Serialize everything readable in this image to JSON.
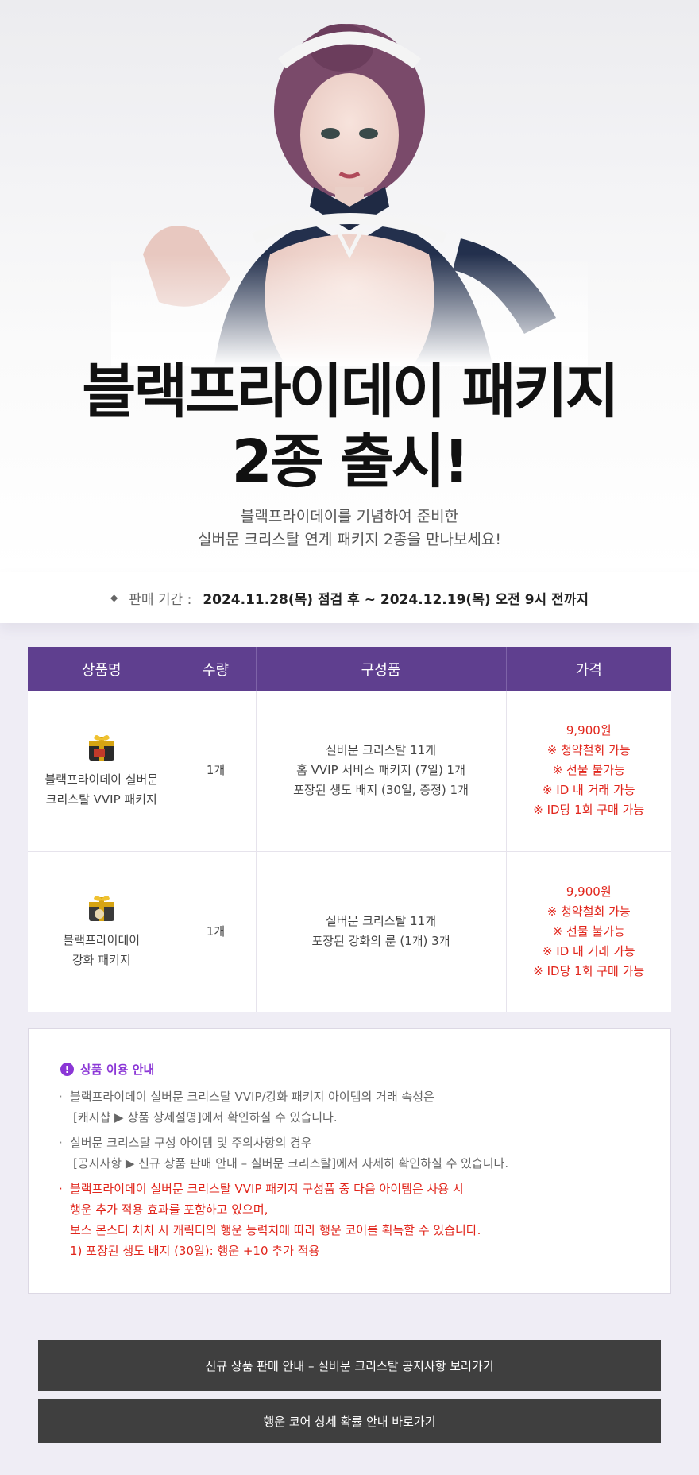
{
  "hero": {
    "headline_line1": "블랙프라이데이 패키지",
    "headline_line2": "2종 출시!",
    "sub_line1": "블랙프라이데이를 기념하여 준비한",
    "sub_line2": "실버문 크리스탈 연계 패키지 2종을 만나보세요!"
  },
  "period": {
    "label": "판매 기간 :",
    "value": "2024.11.28(목) 점검 후 ~ 2024.12.19(목) 오전 9시 전까지"
  },
  "table": {
    "headers": [
      "상품명",
      "수량",
      "구성품",
      "가격"
    ],
    "rows": [
      {
        "icon": "vvip-package-box-icon",
        "name_line1": "블랙프라이데이 실버문",
        "name_line2": "크리스탈 VVIP 패키지",
        "qty": "1개",
        "items": [
          "실버문 크리스탈 11개",
          "홈 VVIP 서비스 패키지 (7일) 1개",
          "포장된 생도 배지 (30일, 증정) 1개"
        ],
        "price": [
          "9,900원",
          "※ 청약철회 가능",
          "※ 선물 불가능",
          "※ ID 내 거래 가능",
          "※ ID당 1회 구매 가능"
        ]
      },
      {
        "icon": "enhance-package-box-icon",
        "name_line1": "블랙프라이데이",
        "name_line2": "강화 패키지",
        "qty": "1개",
        "items": [
          "실버문 크리스탈 11개",
          "포장된 강화의 룬 (1개) 3개"
        ],
        "price": [
          "9,900원",
          "※ 청약철회 가능",
          "※ 선물 불가능",
          "※ ID 내 거래 가능",
          "※ ID당 1회 구매 가능"
        ]
      }
    ]
  },
  "notice": {
    "title": "상품 이용 안내",
    "items": [
      {
        "lines": [
          "블랙프라이데이 실버문 크리스탈 VVIP/강화 패키지 아이템의 거래 속성은",
          "[캐시샵 ▶ 상품 상세설명]에서 확인하실 수 있습니다."
        ]
      },
      {
        "lines": [
          "실버문 크리스탈 구성 아이템 및 주의사항의 경우",
          "[공지사항 ▶ 신규 상품 판매 안내 – 실버문 크리스탈]에서 자세히 확인하실 수 있습니다."
        ]
      },
      {
        "lines": [
          "블랙프라이데이 실버문 크리스탈 VVIP  패키지 구성품 중 다음 아이템은 사용 시",
          "행운 추가 적용 효과를 포함하고 있으며,",
          "보스 몬스터 처치 시 캐릭터의 행운 능력치에 따라 행운 코어를 획득할 수 있습니다.",
          "1) 포장된 생도 배지 (30일): 행운 +10 추가 적용"
        ]
      }
    ]
  },
  "buttons": {
    "notice_link": "신규 상품 판매 안내 – 실버문 크리스탈 공지사항 보러가기",
    "probability_link": "행운 코어 상세 확률 안내 바로가기"
  },
  "colors": {
    "table_header": "#5f3f8f",
    "price_red": "#e1251b",
    "notice_purple": "#8b36d6",
    "button_dark": "#3f3f3f"
  }
}
